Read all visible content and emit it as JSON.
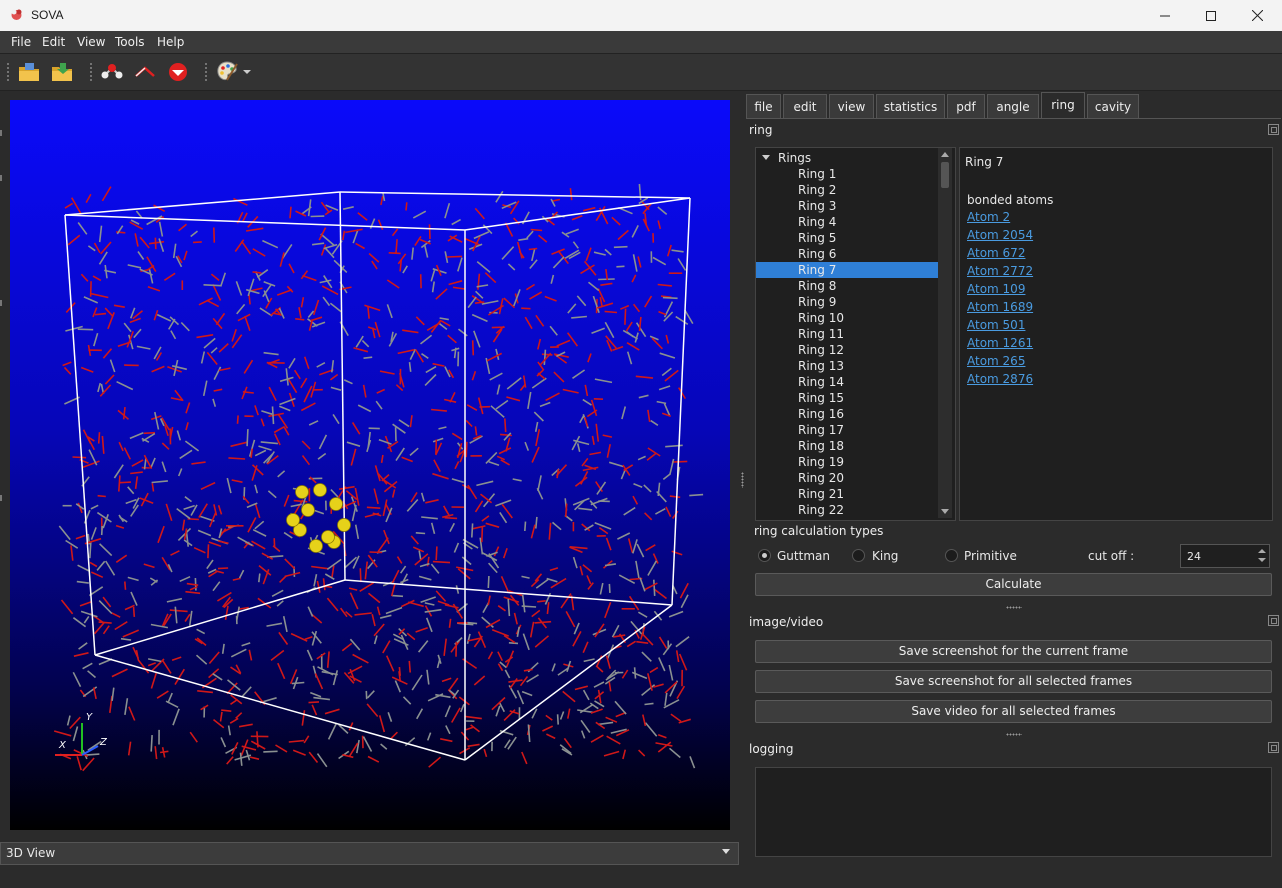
{
  "window": {
    "title": "SOVA",
    "icons": {
      "app": "sova-logo-icon",
      "minimize": "minimize-icon",
      "maximize": "maximize-icon",
      "close": "close-icon"
    }
  },
  "menu": [
    "File",
    "Edit",
    "View",
    "Tools",
    "Help"
  ],
  "toolbar": {
    "icons": [
      "open-folder-icon",
      "open-project-icon",
      "molecule-bond-icon",
      "angle-icon",
      "atom-sphere-icon",
      "palette-icon",
      "dropdown-arrow-icon"
    ]
  },
  "viewport": {
    "axes": {
      "x": "X",
      "y": "Y",
      "z": "Z"
    },
    "selector": "3D View"
  },
  "tabs": [
    "file",
    "edit",
    "view",
    "statistics",
    "pdf",
    "angle",
    "ring",
    "cavity"
  ],
  "active_tab": "ring",
  "ring_panel": {
    "title": "ring",
    "tree_root": "Rings",
    "rings": [
      "Ring 1",
      "Ring 2",
      "Ring 3",
      "Ring 4",
      "Ring 5",
      "Ring 6",
      "Ring 7",
      "Ring 8",
      "Ring 9",
      "Ring 10",
      "Ring 11",
      "Ring 12",
      "Ring 13",
      "Ring 14",
      "Ring 15",
      "Ring 16",
      "Ring 17",
      "Ring 18",
      "Ring 19",
      "Ring 20",
      "Ring 21",
      "Ring 22"
    ],
    "selected": "Ring 7",
    "detail": {
      "heading": "Ring 7",
      "subheading": "bonded atoms",
      "atoms": [
        "Atom 2",
        "Atom 2054",
        "Atom 672",
        "Atom 2772",
        "Atom 109",
        "Atom 1689",
        "Atom 501",
        "Atom 1261",
        "Atom 265",
        "Atom 2876"
      ]
    },
    "calc_label": "ring calculation types",
    "methods": [
      {
        "label": "Guttman",
        "checked": true
      },
      {
        "label": "King",
        "checked": false
      },
      {
        "label": "Primitive",
        "checked": false
      }
    ],
    "cutoff_label": "cut off :",
    "cutoff_value": "24",
    "calculate": "Calculate"
  },
  "image_video": {
    "title": "image/video",
    "buttons": [
      "Save screenshot for the current frame",
      "Save screenshot for all selected frames",
      "Save video for all selected frames"
    ]
  },
  "logging": {
    "title": "logging",
    "content": ""
  }
}
